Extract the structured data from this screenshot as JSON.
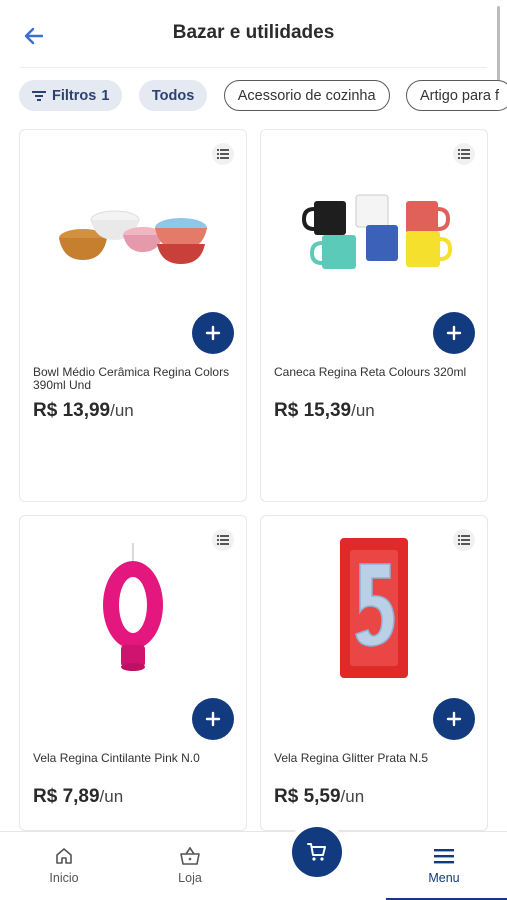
{
  "header": {
    "title": "Bazar e utilidades",
    "back_icon": "arrow-left-icon"
  },
  "filters": {
    "filter_label": "Filtros",
    "filter_count": "1",
    "chips": [
      "Todos",
      "Acessorio de cozinha",
      "Artigo para f"
    ]
  },
  "products": [
    {
      "name": "Bowl Médio Cerâmica Regina Colors 390ml Und",
      "price": "R$ 13,99",
      "unit": "/un",
      "image": "ceramic-bowls"
    },
    {
      "name": "Caneca Regina Reta Colours 320ml",
      "price": "R$ 15,39",
      "unit": "/un",
      "image": "colored-mugs"
    },
    {
      "name": "Vela Regina Cintilante Pink N.0",
      "price": "R$ 7,89",
      "unit": "/un",
      "image": "pink-candle-zero"
    },
    {
      "name": "Vela Regina Glitter Prata N.5",
      "price": "R$ 5,59",
      "unit": "/un",
      "image": "silver-candle-five"
    }
  ],
  "nav": {
    "items": [
      "Inicio",
      "Loja",
      "Menu"
    ],
    "active": "Menu"
  },
  "colors": {
    "primary": "#123a7e",
    "chip_filled_bg": "#e4e9f2",
    "accent_blue": "#3b6fd4"
  }
}
